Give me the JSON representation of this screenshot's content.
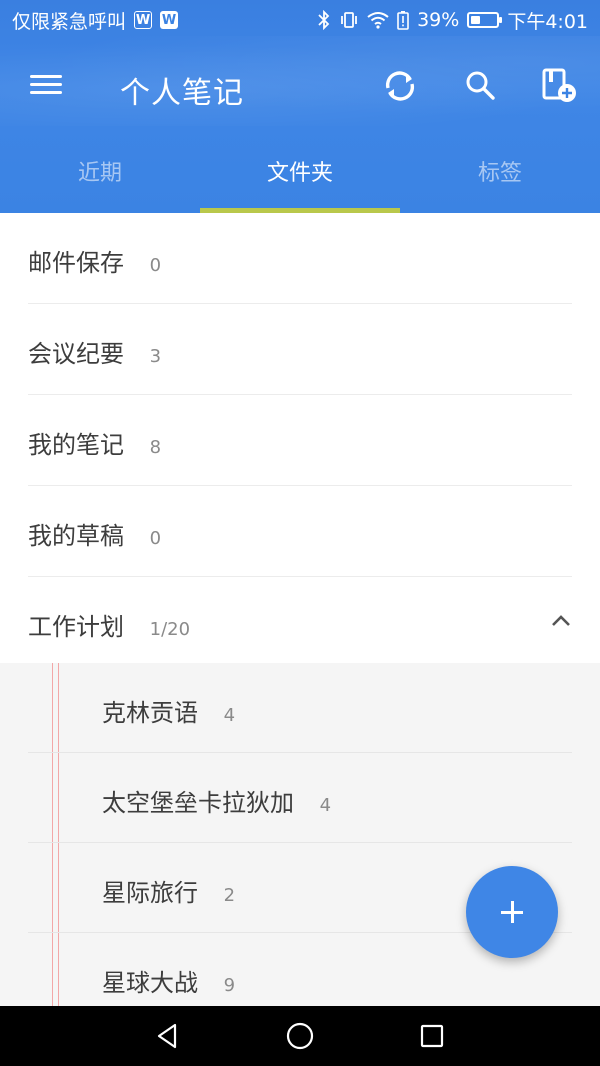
{
  "status_bar": {
    "carrier": "仅限紧急呼叫",
    "battery_percent": "39%",
    "time": "下午4:01",
    "icons": [
      "w-badge-icon",
      "w-badge-icon",
      "bluetooth-icon",
      "vibrate-icon",
      "wifi-icon",
      "battery-icon"
    ]
  },
  "toolbar": {
    "title": "个人笔记",
    "icons": [
      "menu-icon",
      "sync-icon",
      "search-icon",
      "new-notebook-icon"
    ]
  },
  "tabs": [
    {
      "label": "近期",
      "active": false
    },
    {
      "label": "文件夹",
      "active": true
    },
    {
      "label": "标签",
      "active": false
    }
  ],
  "folders": [
    {
      "name": "邮件保存",
      "count": "0"
    },
    {
      "name": "会议纪要",
      "count": "3"
    },
    {
      "name": "我的笔记",
      "count": "8"
    },
    {
      "name": "我的草稿",
      "count": "0"
    },
    {
      "name": "工作计划",
      "count": "1/20",
      "expanded": true
    }
  ],
  "subfolders": [
    {
      "name": "克林贡语",
      "count": "4"
    },
    {
      "name": "太空堡垒卡拉狄加",
      "count": "4"
    },
    {
      "name": "星际旅行",
      "count": "2"
    },
    {
      "name": "星球大战",
      "count": "9"
    }
  ],
  "colors": {
    "header": "#3b83e3",
    "tab_indicator": "#b9c84b",
    "fab": "#3f86e6",
    "margin_line": "#f3a7a7"
  },
  "fab_icon": "plus-icon",
  "nav_icons": [
    "back-icon",
    "home-icon",
    "recents-icon"
  ]
}
